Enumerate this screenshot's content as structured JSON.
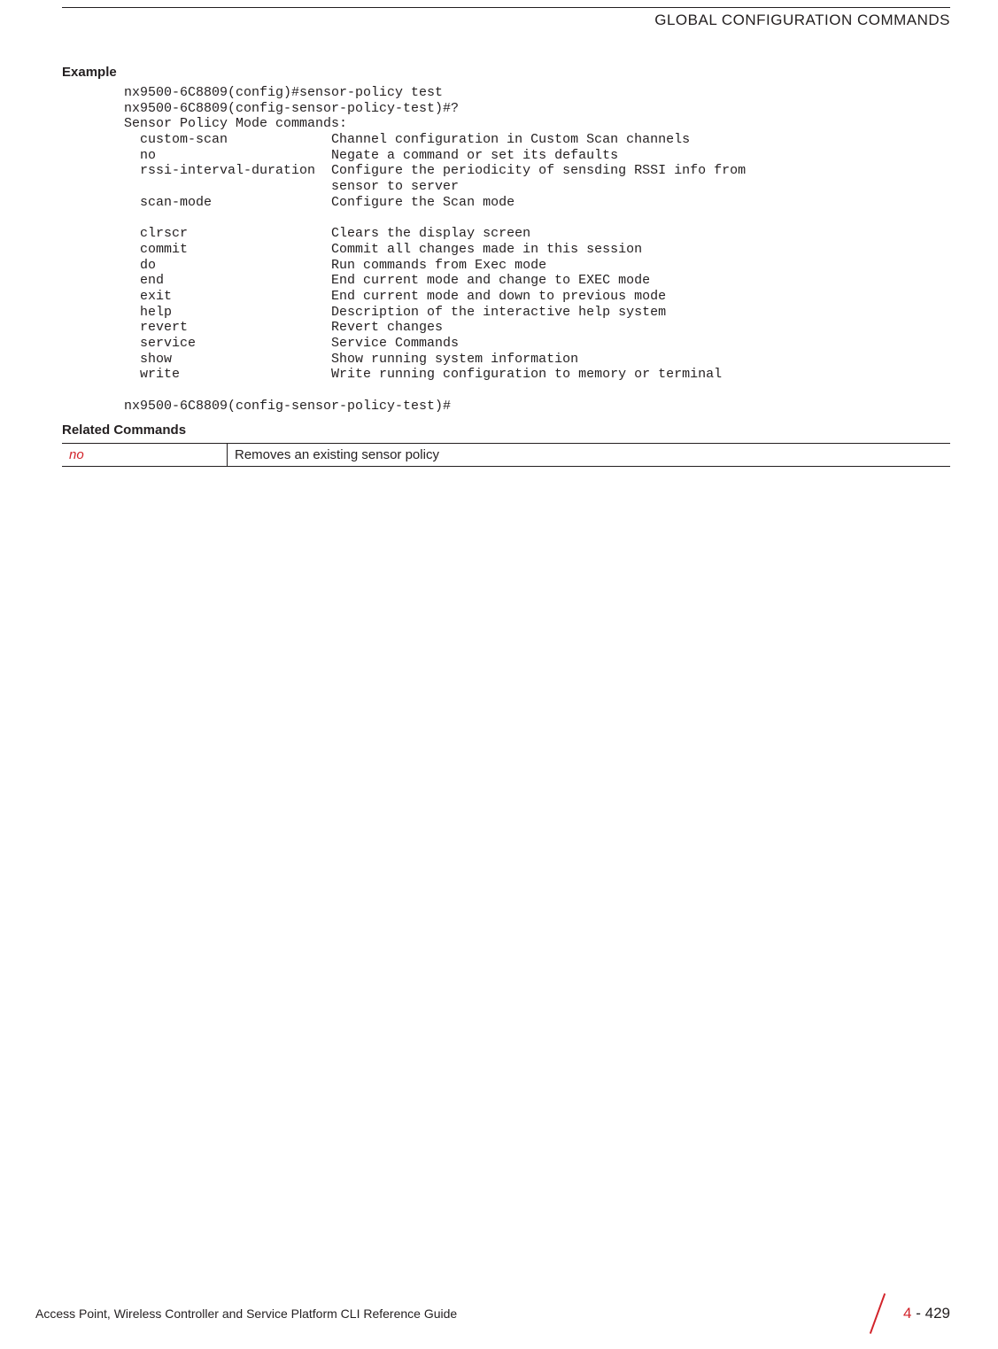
{
  "header": {
    "title": "GLOBAL CONFIGURATION COMMANDS"
  },
  "sections": {
    "example_heading": "Example",
    "related_heading": "Related Commands"
  },
  "cli": {
    "block": "nx9500-6C8809(config)#sensor-policy test\nnx9500-6C8809(config-sensor-policy-test)#?\nSensor Policy Mode commands:\n  custom-scan             Channel configuration in Custom Scan channels\n  no                      Negate a command or set its defaults\n  rssi-interval-duration  Configure the periodicity of sensding RSSI info from\n                          sensor to server\n  scan-mode               Configure the Scan mode\n\n  clrscr                  Clears the display screen\n  commit                  Commit all changes made in this session\n  do                      Run commands from Exec mode\n  end                     End current mode and change to EXEC mode\n  exit                    End current mode and down to previous mode\n  help                    Description of the interactive help system\n  revert                  Revert changes\n  service                 Service Commands\n  show                    Show running system information\n  write                   Write running configuration to memory or terminal\n\nnx9500-6C8809(config-sensor-policy-test)#"
  },
  "related": [
    {
      "cmd": "no",
      "desc": "Removes an existing sensor policy"
    }
  ],
  "footer": {
    "guide": "Access Point, Wireless Controller and Service Platform CLI Reference Guide",
    "page_section": "4",
    "page_sep": " - ",
    "page_number": "429"
  }
}
